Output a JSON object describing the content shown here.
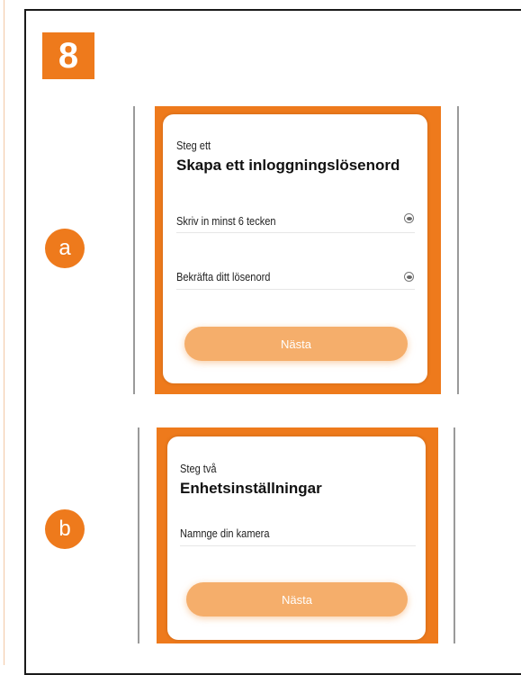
{
  "step_number": "8",
  "panel_a": {
    "marker": "a",
    "step_label": "Steg ett",
    "title": "Skapa ett inloggningslösenord",
    "fields": [
      {
        "label": "Skriv in minst 6 tecken"
      },
      {
        "label": "Bekräfta ditt lösenord"
      }
    ],
    "next_label": "Nästa"
  },
  "panel_b": {
    "marker": "b",
    "step_label": "Steg två",
    "title": "Enhetsinställningar",
    "fields": [
      {
        "label": "Namnge din kamera"
      }
    ],
    "next_label": "Nästa"
  },
  "colors": {
    "accent": "#ee7a1c",
    "button": "#f5ae6b"
  },
  "icons": {
    "password_toggle": "eye-icon"
  }
}
